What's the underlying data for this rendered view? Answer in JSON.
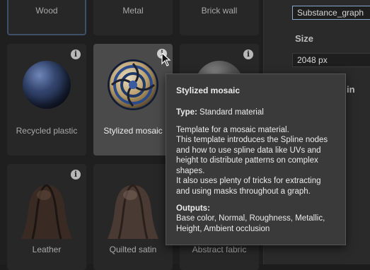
{
  "materials_row1": [
    {
      "label": "Wood"
    },
    {
      "label": "Metal"
    },
    {
      "label": "Brick wall"
    }
  ],
  "materials_row2": [
    {
      "label": "Recycled plastic"
    },
    {
      "label": "Stylized mosaic"
    },
    {
      "label": ""
    }
  ],
  "materials_row3": [
    {
      "label": "Leather"
    },
    {
      "label": "Quilted satin"
    },
    {
      "label": "Abstract fabric"
    }
  ],
  "info_glyph": "i",
  "sidebar": {
    "name_value": "Substance_graph",
    "size_label": "Size",
    "size_value": "2048 px",
    "partial_text": "in"
  },
  "tooltip": {
    "title": "Stylized mosaic",
    "type_label": "Type:",
    "type_value": "Standard material",
    "description_lines": [
      "Template for a mosaic material.",
      "This template introduces the Spline nodes and how to use spline data like UVs and height to distribute patterns on complex shapes.",
      "It also uses plenty of tricks for extracting and using masks throughout a graph."
    ],
    "outputs_label": "Outputs:",
    "outputs_value": "Base color, Normal, Roughness, Metallic, Height, Ambient occlusion"
  },
  "colors": {
    "background": "#1f1f1f",
    "card": "#272727",
    "card_hover": "#4a4a4a",
    "tooltip": "#3a3a3a",
    "focus_border": "#8aa8d0"
  }
}
